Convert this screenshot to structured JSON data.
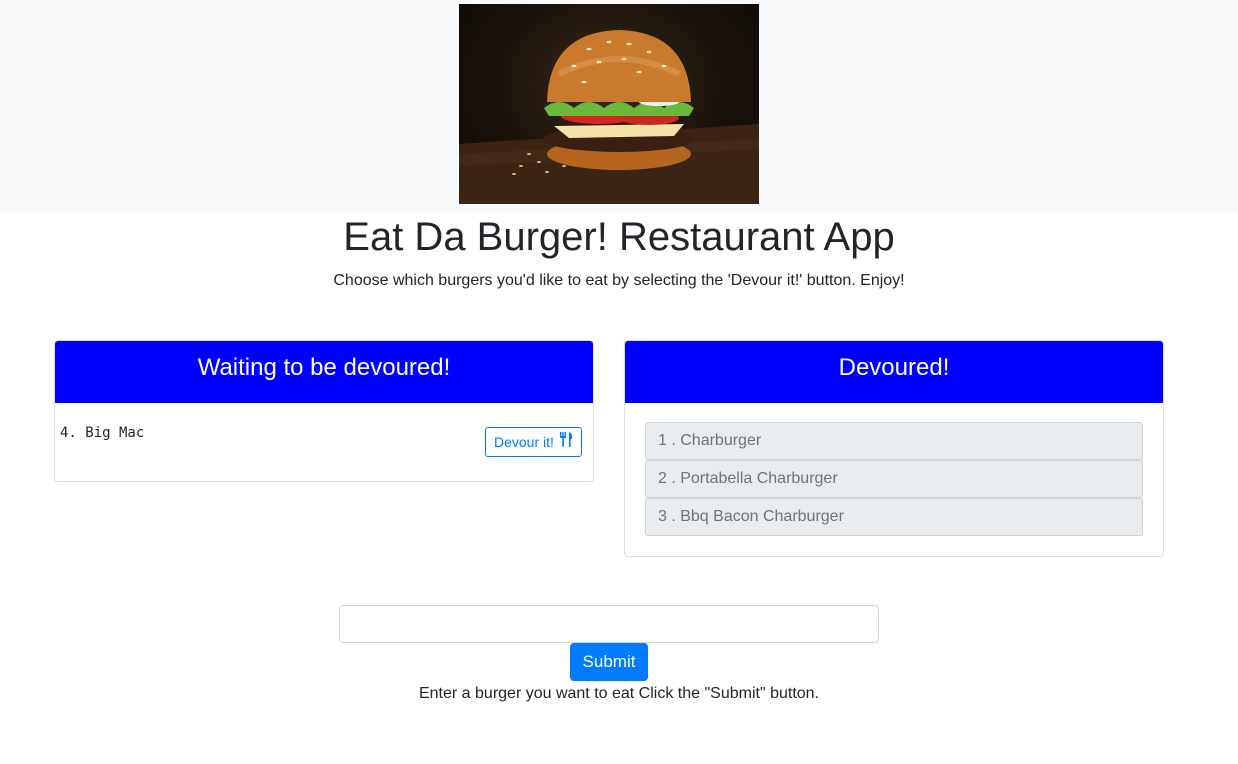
{
  "hero": {
    "image_icon": "burger-photo"
  },
  "title": "Eat Da Burger! Restaurant App",
  "subtitle": "Choose which burgers you'd like to eat by selecting the 'Devour it!' button. Enjoy!",
  "waiting": {
    "header": "Waiting to be devoured!",
    "items": [
      {
        "label": "4. Big Mac",
        "button_label": "Devour it!",
        "button_icon": "utensils-icon"
      }
    ]
  },
  "devoured": {
    "header": "Devoured!",
    "items": [
      {
        "label": "1 . Charburger"
      },
      {
        "label": "2 . Portabella Charburger"
      },
      {
        "label": "3 . Bbq Bacon Charburger"
      }
    ]
  },
  "form": {
    "input_value": "",
    "input_placeholder": "",
    "submit_label": "Submit",
    "instructions": "Enter a burger you want to eat Click the \"Submit\" button."
  },
  "colors": {
    "card_header": "#0000ff",
    "primary": "#007bff",
    "list_item_bg": "#e9ecef"
  }
}
